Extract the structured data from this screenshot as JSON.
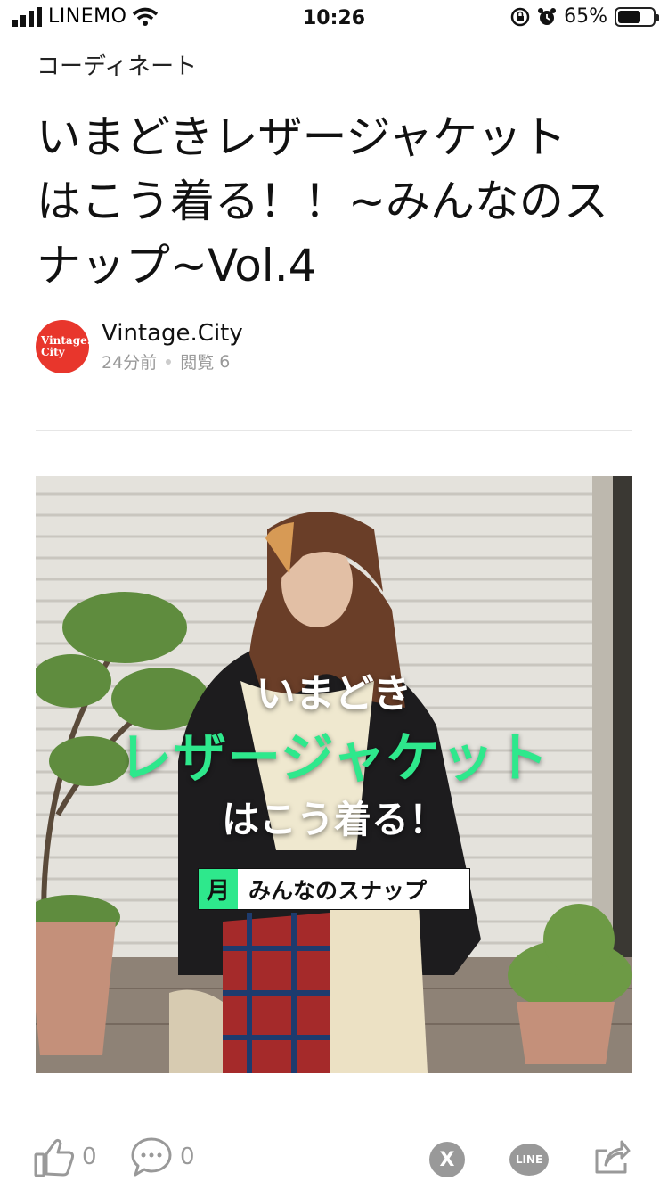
{
  "status_bar": {
    "carrier": "LINEMO",
    "time": "10:26",
    "battery_percent": "65%",
    "battery_level": 0.65
  },
  "article": {
    "category": "コーディネート",
    "title_lines": [
      "いまどきレザージャケット",
      "はこう着る！！~みんなのス",
      "ナップ~Vol.4"
    ],
    "author": {
      "avatar_text_1": "Vintage.",
      "avatar_text_2": "City",
      "name": "Vintage.City",
      "time_ago": "24分前",
      "views_label": "閲覧",
      "views": "6"
    }
  },
  "hero": {
    "line1": "いまどき",
    "line2": "レザージャケット",
    "line3": "はこう着る！",
    "badge_month": "月",
    "badge_text": "みんなのスナップ"
  },
  "bottom_bar": {
    "like_count": "0",
    "comment_count": "0",
    "x_label": "X",
    "line_label": "LINE"
  },
  "colors": {
    "accent_green": "#2ee88c",
    "avatar_red": "#e8362c",
    "icon_gray": "#999999"
  }
}
